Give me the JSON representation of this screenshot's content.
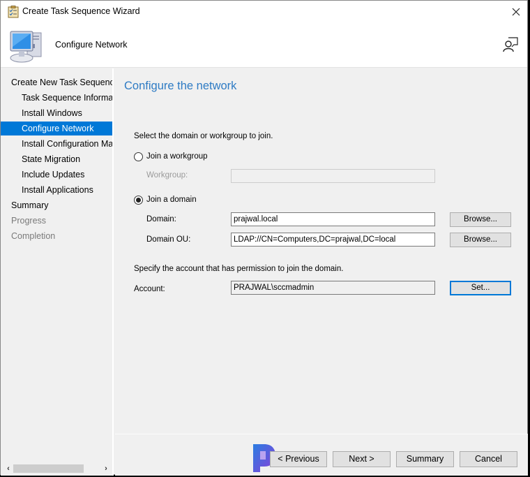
{
  "window": {
    "title": "Create Task Sequence Wizard",
    "close_icon": "close-icon",
    "app_icon": "task-sequence-clipboard-icon"
  },
  "header": {
    "title": "Configure Network",
    "banner_icon": "computer-network-icon",
    "help_icon": "user-help-icon"
  },
  "sidebar": {
    "items": [
      {
        "label": "Create New Task Sequence",
        "level": 0,
        "state": "normal"
      },
      {
        "label": "Task Sequence Information",
        "level": 1,
        "state": "normal"
      },
      {
        "label": "Install Windows",
        "level": 1,
        "state": "normal"
      },
      {
        "label": "Configure Network",
        "level": 1,
        "state": "active"
      },
      {
        "label": "Install Configuration Manager",
        "level": 1,
        "state": "normal"
      },
      {
        "label": "State Migration",
        "level": 1,
        "state": "normal"
      },
      {
        "label": "Include Updates",
        "level": 1,
        "state": "normal"
      },
      {
        "label": "Install Applications",
        "level": 1,
        "state": "normal"
      },
      {
        "label": "Summary",
        "level": 0,
        "state": "normal"
      },
      {
        "label": "Progress",
        "level": 0,
        "state": "disabled"
      },
      {
        "label": "Completion",
        "level": 0,
        "state": "disabled"
      }
    ],
    "scroll_left": "‹",
    "scroll_right": "›"
  },
  "main": {
    "page_title": "Configure the network",
    "instruction": "Select the domain or workgroup to join.",
    "workgroup_option": {
      "label": "Join a workgroup",
      "checked": false
    },
    "workgroup_label": "Workgroup:",
    "workgroup_value": "",
    "domain_option": {
      "label": "Join a domain",
      "checked": true
    },
    "domain_label": "Domain:",
    "domain_value": "prajwal.local",
    "domain_browse": "Browse...",
    "ou_label": "Domain OU:",
    "ou_value": "LDAP://CN=Computers,DC=prajwal,DC=local",
    "ou_browse": "Browse...",
    "account_instruction": "Specify the account that has permission to join the domain.",
    "account_label": "Account:",
    "account_value": "PRAJWAL\\sccmadmin",
    "account_set": "Set..."
  },
  "footer": {
    "previous": "< Previous",
    "next": "Next >",
    "summary": "Summary",
    "cancel": "Cancel",
    "watermark_logo": "prajwal-logo-icon"
  },
  "colors": {
    "accent": "#0078d7",
    "title_blue": "#2e7bc4",
    "background": "#f0f0f0"
  }
}
